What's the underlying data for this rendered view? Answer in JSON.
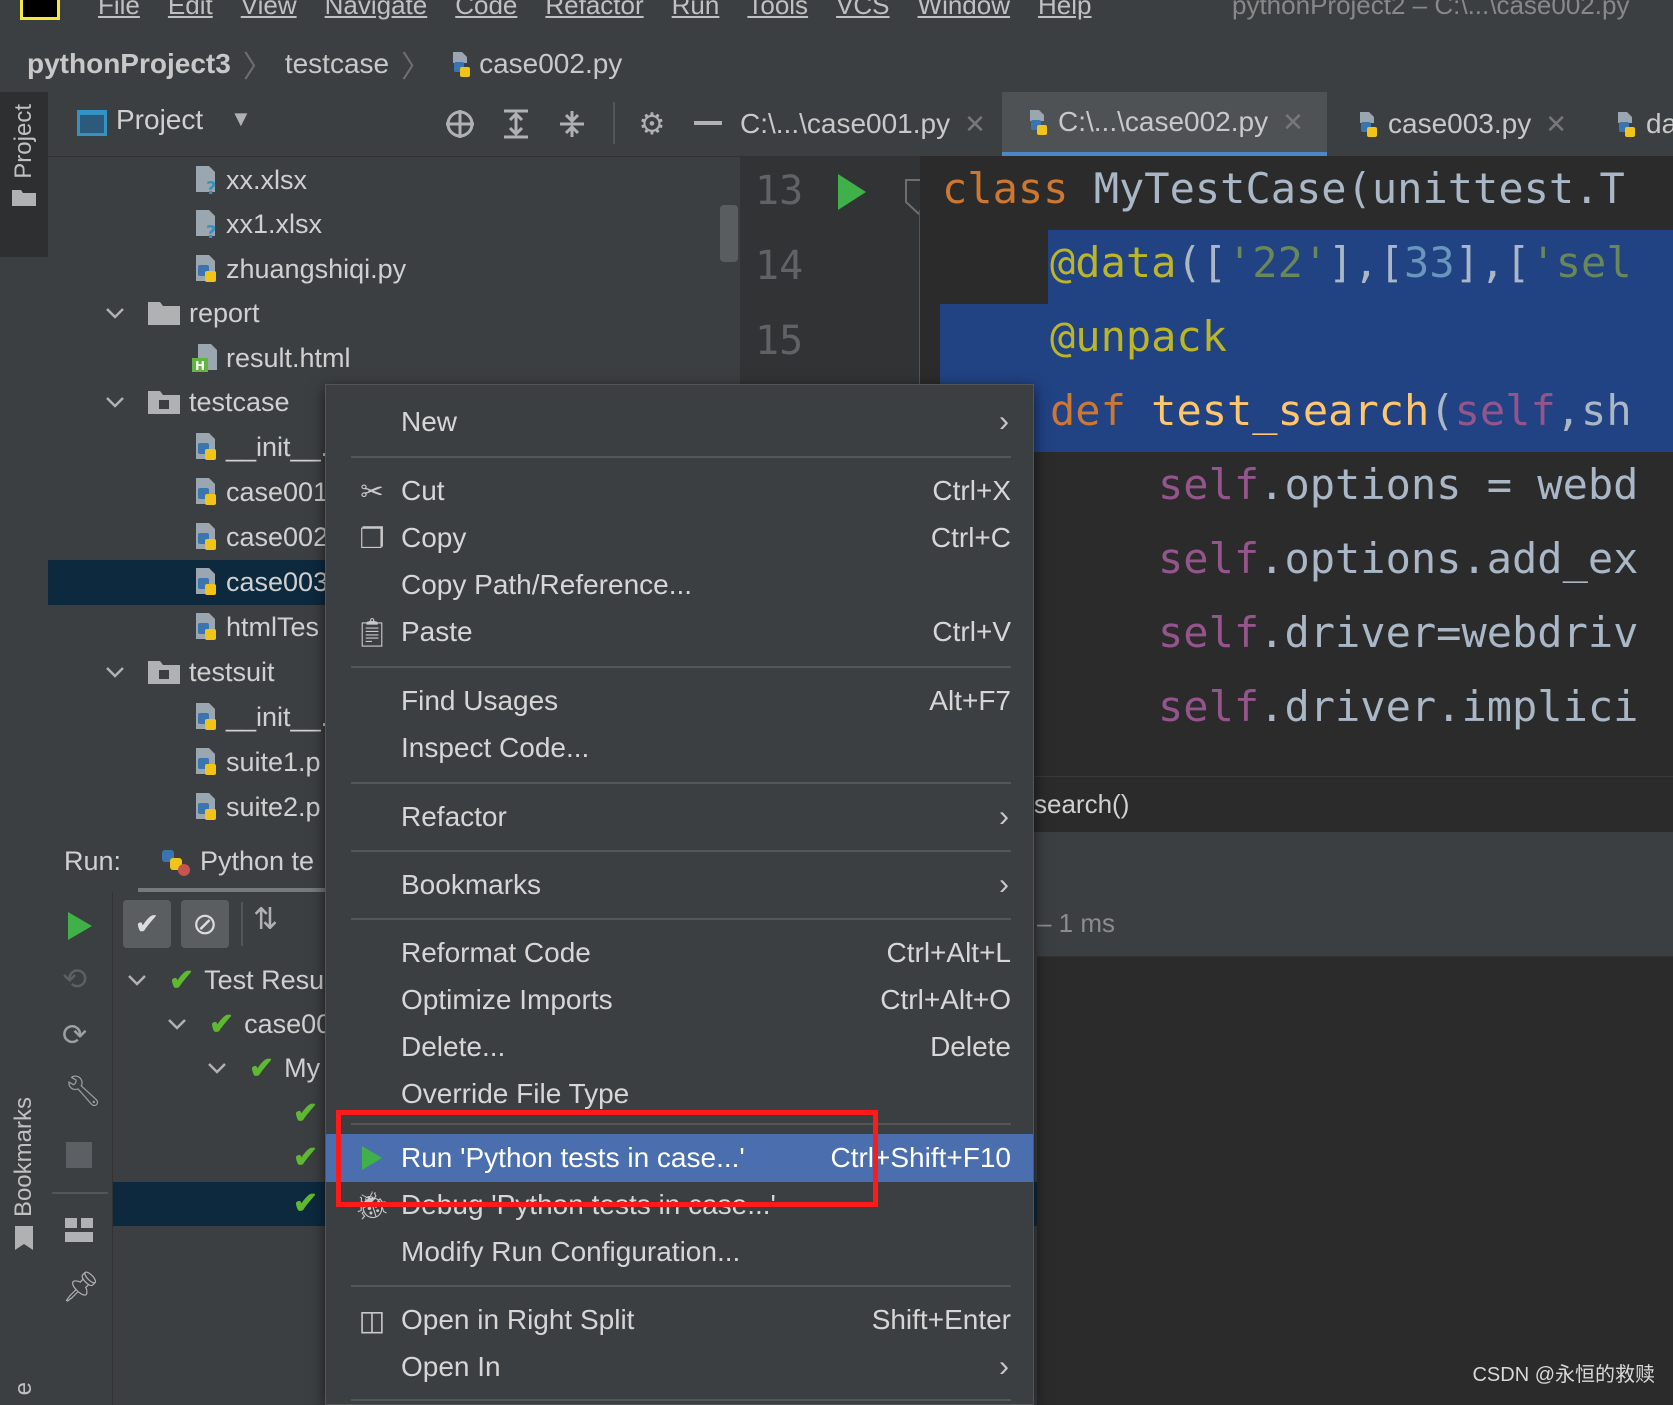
{
  "menubar": {
    "items": [
      "File",
      "Edit",
      "View",
      "Navigate",
      "Code",
      "Refactor",
      "Run",
      "Tools",
      "VCS",
      "Window",
      "Help"
    ],
    "window_title": "pythonProject2 – C:\\...\\case002.py"
  },
  "breadcrumb": [
    "pythonProject3",
    "testcase",
    "case002.py"
  ],
  "left_strip": {
    "project": "Project",
    "bookmarks": "Bookmarks",
    "bottom_fragment": "e"
  },
  "project_panel": {
    "title": "Project",
    "tree": [
      {
        "name": "xx.xlsx",
        "type": "unknown-file"
      },
      {
        "name": "xx1.xlsx",
        "type": "unknown-file"
      },
      {
        "name": "zhuangshiqi.py",
        "type": "python"
      },
      {
        "name": "report",
        "type": "folder",
        "expanded": true
      },
      {
        "name": "result.html",
        "type": "html"
      },
      {
        "name": "testcase",
        "type": "package",
        "expanded": true
      },
      {
        "name": "__init__.",
        "type": "python"
      },
      {
        "name": "case001",
        "type": "python"
      },
      {
        "name": "case002",
        "type": "python"
      },
      {
        "name": "case003",
        "type": "python",
        "selected": true
      },
      {
        "name": "htmlTes",
        "type": "python"
      },
      {
        "name": "testsuit",
        "type": "package",
        "expanded": true
      },
      {
        "name": "__init__.",
        "type": "python"
      },
      {
        "name": "suite1.p",
        "type": "python"
      },
      {
        "name": "suite2.p",
        "type": "python"
      }
    ]
  },
  "editor": {
    "tabs": [
      {
        "label": "C:\\...\\case001.py",
        "active": false
      },
      {
        "label": "C:\\...\\case002.py",
        "active": true
      },
      {
        "label": "case003.py",
        "active": false
      },
      {
        "label": "da",
        "active": false
      }
    ],
    "line_numbers": [
      "13",
      "14",
      "15"
    ],
    "code_lines": {
      "l13": [
        "class",
        " ",
        "MyTestCase(unittest.T"
      ],
      "l14": [
        "@data",
        "([",
        "'22'",
        "],[",
        "33",
        "],[",
        "'sel"
      ],
      "l15": [
        "@unpack"
      ],
      "l16": [
        "def",
        " ",
        "test_search",
        "(",
        "self",
        ",sh"
      ],
      "l17": [
        "self",
        ".options = webd"
      ],
      "l18": [
        "self",
        ".options.add_ex"
      ],
      "l19": [
        "self",
        ".driver=webdriv"
      ],
      "l20": [
        "self",
        ".driver.implici"
      ]
    },
    "structure_text": "search()"
  },
  "run_panel": {
    "label": "Run:",
    "config_tab": "Python te",
    "timing": "– 1 ms",
    "tree": [
      "Test Resu",
      "case00",
      "My"
    ]
  },
  "context_menu": {
    "items": [
      {
        "label": "New",
        "shortcut": "",
        "submenu": true
      },
      {
        "label": "Cut",
        "shortcut": "Ctrl+X",
        "icon": "scissors-icon"
      },
      {
        "label": "Copy",
        "shortcut": "Ctrl+C",
        "icon": "copy-icon"
      },
      {
        "label": "Copy Path/Reference...",
        "shortcut": ""
      },
      {
        "label": "Paste",
        "shortcut": "Ctrl+V",
        "icon": "clipboard-icon"
      },
      {
        "label": "Find Usages",
        "shortcut": "Alt+F7"
      },
      {
        "label": "Inspect Code...",
        "shortcut": ""
      },
      {
        "label": "Refactor",
        "shortcut": "",
        "submenu": true
      },
      {
        "label": "Bookmarks",
        "shortcut": "",
        "submenu": true
      },
      {
        "label": "Reformat Code",
        "shortcut": "Ctrl+Alt+L"
      },
      {
        "label": "Optimize Imports",
        "shortcut": "Ctrl+Alt+O"
      },
      {
        "label": "Delete...",
        "shortcut": "Delete"
      },
      {
        "label": "Override File Type",
        "shortcut": ""
      },
      {
        "label": "Run 'Python tests in case...'",
        "shortcut": "Ctrl+Shift+F10",
        "icon": "run-icon",
        "highlighted": true
      },
      {
        "label": "Debug 'Python tests in case...'",
        "shortcut": "",
        "icon": "debug-icon"
      },
      {
        "label": "Modify Run Configuration...",
        "shortcut": ""
      },
      {
        "label": "Open in Right Split",
        "shortcut": "Shift+Enter",
        "icon": "split-icon"
      },
      {
        "label": "Open In",
        "shortcut": "",
        "submenu": true
      }
    ]
  },
  "watermark": "CSDN @永恒的救赎",
  "colors": {
    "selection": "#214283",
    "menu_highlight": "#4b6eaf",
    "annotation_box": "#ff1a1a",
    "check_green": "#5fb832"
  }
}
